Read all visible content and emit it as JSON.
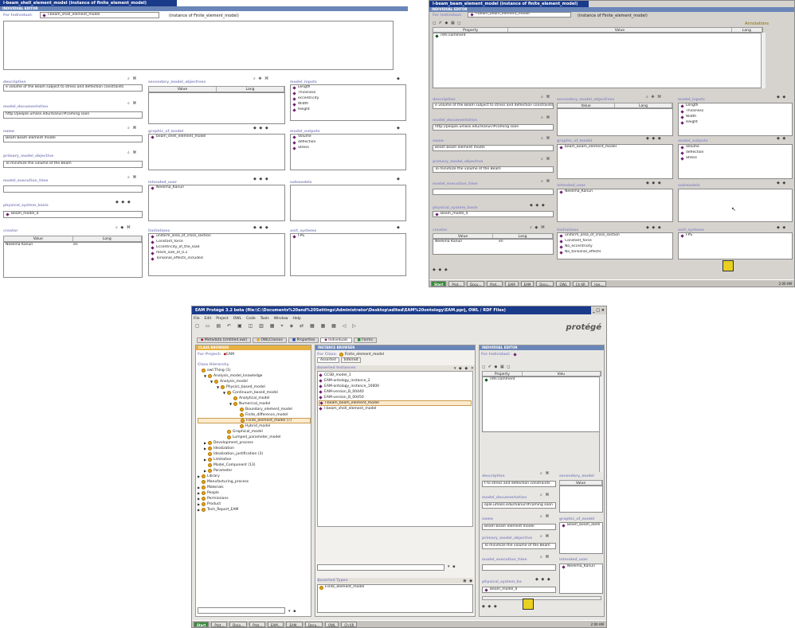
{
  "left": {
    "title": "l-beam_shell_element_model (instance of finite_element_model)",
    "editor_label": "INDIVIDUAL EDITOR",
    "for_individual_label": "For Individual:",
    "for_individual_value": "l-beam_shell_element_model",
    "instance_of": "(instance of Finite_element_model)",
    "description_label": "description",
    "description_value": "e volume of the Beam subject to stress and deflection constraints",
    "model_documentation_label": "model_documentation",
    "model_documentation_value": "http://people.umass.edu/rkanur/#coming soon",
    "name_label": "name",
    "name_value": "Beam beam element model",
    "primary_objective_label": "primary_model_objective",
    "primary_objective_value": "To minimize the volume of the Beam",
    "execution_time_label": "model_execution_time",
    "physical_system_label": "physical_system_basis",
    "physical_system_item": "Beam_model_4",
    "creator_label": "creator",
    "creator_col_value": "Value",
    "creator_col_lang": "Lang",
    "creator_value": "Neelima Kanuri",
    "creator_lang": "en",
    "secondary_label": "secondary_model_objectives",
    "secondary_col_value": "Value",
    "secondary_col_lang": "Lang",
    "graphic_label": "graphic_of_model",
    "graphic_item": "beam_shell_element_model",
    "intended_user_label": "intended_user",
    "intended_user_item": "Neelima_Kanuri",
    "limitations_label": "limitations",
    "limitations_items": [
      "uniform_area_of_cross_section",
      "Constant_force",
      "Eccentricity_of_the_load",
      "mesh_size_of_0.2",
      "Torsional_effects_included"
    ],
    "inputs_label": "model_inputs",
    "inputs_items": [
      "Length",
      "Thickness",
      "eccentricity",
      "Width",
      "Height"
    ],
    "outputs_label": "model_outputs",
    "outputs_items": [
      "Volume",
      "deflection",
      "Stress"
    ],
    "submodels_label": "submodels",
    "unit_systems_label": "unit_systems",
    "unit_systems_item": "FPS"
  },
  "right": {
    "title": "l-beam_beam_element_model (instance of finite_element_model)",
    "editor_label": "INDIVIDUAL EDITOR",
    "for_individual_label": "For Individual:",
    "for_individual_value": "l-beam_beam_element_model",
    "instance_of": "(instance of Finite_element_model)",
    "annotations_label": "Annotations",
    "col_property": "Property",
    "col_value": "Value",
    "col_lang": "Lang",
    "rdfs_row": "rdfs:comment",
    "description_label": "description",
    "description_value": "e volume of the Beam subject to stress and deflection constraints",
    "model_documentation_label": "model_documentation",
    "model_documentation_value": "http://people.umass.edu/rkanur/#coming soon",
    "name_label": "name",
    "name_value": "Beam beam element model",
    "primary_objective_label": "primary_model_objective",
    "primary_objective_value": "To minimize the volume of the Beam",
    "execution_time_label": "model_execution_time",
    "physical_system_label": "physical_system_basis",
    "physical_system_item": "Beam_model_4",
    "creator_label": "creator",
    "creator_col_value": "Value",
    "creator_col_lang": "Lang",
    "creator_value": "Neelima Kanuri",
    "creator_lang": "en",
    "secondary_label": "secondary_model_objectives",
    "secondary_col_value": "Value",
    "secondary_col_lang": "Lang",
    "graphic_label": "graphic_of_model",
    "graphic_item": "beam_beam_element_model",
    "intended_user_label": "intended_user",
    "intended_user_item": "Neelima_Kanuri",
    "limitations_label": "limitations",
    "limitations_items": [
      "uniform_area_of_cross_section",
      "Constant_force",
      "No_eccentricity",
      "No_torsional_effects"
    ],
    "inputs_label": "model_inputs",
    "inputs_items": [
      "Length",
      "Thickness",
      "Width",
      "Height"
    ],
    "outputs_label": "model_outputs",
    "outputs_items": [
      "Volume",
      "deflection",
      "Stress"
    ],
    "submodels_label": "submodels",
    "unit_systems_label": "unit_systems",
    "unit_systems_item": "FPS",
    "taskbar": [
      "Start",
      "Prot...",
      "Docu...",
      "Prot...",
      "EAM",
      "EAM",
      "Docu...",
      "OWL",
      "Ch 6R",
      "l-be..."
    ],
    "clock": "2:00 AM"
  },
  "main": {
    "title": "EAM Protégé 3.2 beta (file:\\C:\\Documents%20and%20Settings\\Administrator\\Desktop\\edited\\EAM%20ontology\\EAM.pprj, OWL / RDF Files)",
    "menu": [
      "File",
      "Edit",
      "Project",
      "OWL",
      "Code",
      "Tools",
      "Window",
      "Help"
    ],
    "logo": "protégé",
    "tabs": [
      "Metadata (Untitled.owl)",
      "OWLClasses",
      "Properties",
      "Individuals",
      "Forms"
    ],
    "class_browser": {
      "header": "CLASS BROWSER",
      "for_project_label": "For Project:",
      "for_project_value": "EAM",
      "hierarchy_label": "Class Hierarchy",
      "tree": [
        {
          "label": "owl:Thing (1)",
          "level": 0,
          "arrow": ""
        },
        {
          "label": "Analysis_model_knowledge",
          "level": 1,
          "arrow": "▼"
        },
        {
          "label": "Analysis_model",
          "level": 2,
          "arrow": "▼"
        },
        {
          "label": "Physics_based_model",
          "level": 3,
          "arrow": "▼"
        },
        {
          "label": "Continuum_based_model",
          "level": 4,
          "arrow": "▼"
        },
        {
          "label": "Analytical_model",
          "level": 5,
          "arrow": ""
        },
        {
          "label": "Numerical_model",
          "level": 5,
          "arrow": "▼"
        },
        {
          "label": "Boundary_element_model",
          "level": 6,
          "arrow": ""
        },
        {
          "label": "Finite_difference_model",
          "level": 6,
          "arrow": ""
        },
        {
          "label": "Finite_element_model (7)",
          "level": 6,
          "arrow": "",
          "selected": true
        },
        {
          "label": "Hybrid_model",
          "level": 6,
          "arrow": ""
        },
        {
          "label": "Graphical_model",
          "level": 4,
          "arrow": ""
        },
        {
          "label": "Lumped_parameter_model",
          "level": 4,
          "arrow": ""
        },
        {
          "label": "Development_process",
          "level": 1,
          "arrow": "▶"
        },
        {
          "label": "Idealization",
          "level": 1,
          "arrow": "▶"
        },
        {
          "label": "Idealization_justification (3)",
          "level": 1,
          "arrow": ""
        },
        {
          "label": "Limitation",
          "level": 1,
          "arrow": "▶"
        },
        {
          "label": "Model_Component (13)",
          "level": 1,
          "arrow": ""
        },
        {
          "label": "Parameter",
          "level": 1,
          "arrow": "▶"
        },
        {
          "label": "Library",
          "level": 0,
          "arrow": "▶"
        },
        {
          "label": "Manufacturing_process",
          "level": 0,
          "arrow": ""
        },
        {
          "label": "Materials",
          "level": 0,
          "arrow": "▶"
        },
        {
          "label": "People",
          "level": 0,
          "arrow": "▶"
        },
        {
          "label": "Permissions",
          "level": 0,
          "arrow": "▶"
        },
        {
          "label": "Product",
          "level": 0,
          "arrow": "▶"
        },
        {
          "label": "Tech_Report_EAM",
          "level": 0,
          "arrow": "▶"
        }
      ]
    },
    "instance_browser": {
      "header": "INSTANCE BROWSER",
      "for_class_label": "For Class:",
      "for_class_value": "Finite_element_model",
      "tab_asserted": "Asserted",
      "tab_inferred": "Inferred",
      "asserted_instances_label": "Asserted Instances",
      "instances": [
        "CCSB_model_1",
        "EAM-ontology_instance_2",
        "EAM-ontology_instance_10000",
        "EAM-version_B_00440",
        "EAM-version_B_00450",
        "l-beam_beam_element_model",
        "l-beam_shell_element_model"
      ],
      "selected_index": 5,
      "types_label": "Asserted Types",
      "type_item": "Finite_element_model"
    },
    "individual_editor": {
      "header": "INDIVIDUAL EDITOR",
      "for_individual_label": "For Individual:",
      "col_property": "Property",
      "col_value": "Valu",
      "rdfs_row": "rdfs:comment",
      "description_label": "description",
      "description_value": "t to stress and deflection constraints",
      "documentation_label": "model_documentation",
      "documentation_value": "ople.umass.edu/rkanur/#coming soon",
      "name_label": "name",
      "name_value": "Beam beam element model",
      "primary_label": "primary_model_objective",
      "primary_value": "To minimize the volume of the Beam",
      "execution_label": "model_execution_time",
      "physical_label": "physical_system_ba",
      "physical_item": "Beam_model_4",
      "secondary_label": "secondary_model",
      "secondary_col": "Value",
      "graphic_label": "graphic_of_model",
      "graphic_item": "Beam_beam_elem",
      "intended_label": "intended_user",
      "intended_item": "Neelima_Kanuri"
    },
    "taskbar": [
      "Start",
      "Prot...",
      "Docu...",
      "Prot...",
      "EAM...",
      "EAM...",
      "Docu...",
      "OWL",
      "Ch 6R"
    ],
    "clock": "2:00 AM"
  }
}
